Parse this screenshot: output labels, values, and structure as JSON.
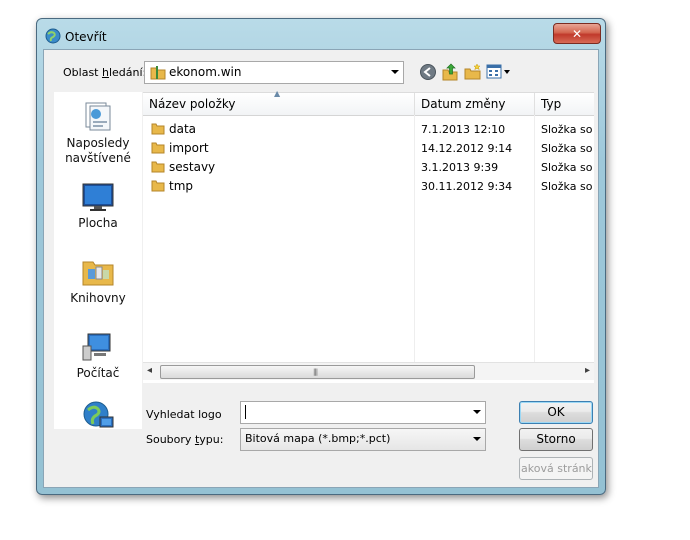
{
  "window": {
    "title": "Otevřít",
    "close_glyph": "✕"
  },
  "lookin": {
    "label_pre": "Oblast ",
    "label_ul": "h",
    "label_post": "ledání:",
    "value": "ekonom.win"
  },
  "toolbar": {
    "back": "back-icon",
    "up": "up-folder-icon",
    "new_folder": "new-folder-icon",
    "views": "views-menu-icon"
  },
  "places": [
    {
      "label_l1": "Naposledy",
      "label_l2": "navštívené",
      "icon": "recent-places-icon"
    },
    {
      "label_l1": "Plocha",
      "label_l2": "",
      "icon": "desktop-icon"
    },
    {
      "label_l1": "Knihovny",
      "label_l2": "",
      "icon": "libraries-icon"
    },
    {
      "label_l1": "Počítač",
      "label_l2": "",
      "icon": "computer-icon"
    },
    {
      "label_l1": "",
      "label_l2": "",
      "icon": "network-icon"
    }
  ],
  "columns": {
    "name": "Název položky",
    "date": "Datum změny",
    "type": "Typ"
  },
  "files": [
    {
      "name": "data",
      "date": "7.1.2013 12:10",
      "type": "Složka sou"
    },
    {
      "name": "import",
      "date": "14.12.2012 9:14",
      "type": "Složka sou"
    },
    {
      "name": "sestavy",
      "date": "3.1.2013 9:39",
      "type": "Složka sou"
    },
    {
      "name": "tmp",
      "date": "30.11.2012 9:34",
      "type": "Složka sou"
    }
  ],
  "form": {
    "search_label": "Vyhledat logo",
    "search_value": "",
    "types_label_pre": "Soubory ",
    "types_label_ul": "t",
    "types_label_post": "ypu:",
    "types_value": "Bitová mapa (*.bmp;*.pct)"
  },
  "buttons": {
    "ok": "OK",
    "cancel": "Storno",
    "web": "iaková stránka"
  },
  "colors": {
    "accent": "#3c7fb1",
    "close": "#c0392b",
    "folder": "#e8b84a"
  }
}
